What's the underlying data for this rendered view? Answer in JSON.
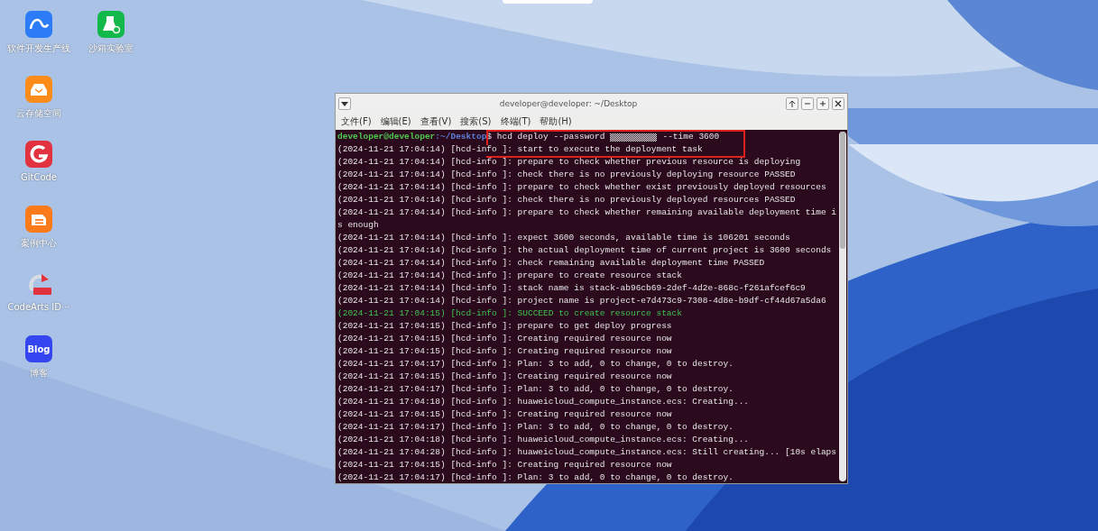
{
  "desktop_icons": [
    {
      "label": "软件开发生产线",
      "kind": "pipeline"
    },
    {
      "label": "沙箱实验室",
      "kind": "sandbox"
    },
    {
      "label": "云存储空间",
      "kind": "storage"
    },
    {
      "label": "GitCode",
      "kind": "gitcode"
    },
    {
      "label": "案例中心",
      "kind": "cases"
    },
    {
      "label": "CodeArts ID···",
      "kind": "java"
    },
    {
      "label": "博客",
      "kind": "blog",
      "badge": "Blog"
    }
  ],
  "terminal": {
    "title": "developer@developer: ~/Desktop",
    "menu": [
      "文件(F)",
      "编辑(E)",
      "查看(V)",
      "搜索(S)",
      "终端(T)",
      "帮助(H)"
    ],
    "prompt": {
      "user": "developer@developer",
      "path": ":~/Desktop",
      "command": "$ hcd deploy --password",
      "command_end": "--time 3600"
    },
    "lines": [
      {
        "text": "(2024-11-21 17:04:14) [hcd-info ]: start to execute the deployment task",
        "kind": "normal"
      },
      {
        "text": "(2024-11-21 17:04:14) [hcd-info ]: prepare to check whether previous resource is deploying",
        "kind": "normal"
      },
      {
        "text": "(2024-11-21 17:04:14) [hcd-info ]: check there is no previously deploying resource PASSED",
        "kind": "normal"
      },
      {
        "text": "(2024-11-21 17:04:14) [hcd-info ]: prepare to check whether exist previously deployed resources",
        "kind": "normal"
      },
      {
        "text": "(2024-11-21 17:04:14) [hcd-info ]: check there is no previously deployed resources PASSED",
        "kind": "normal"
      },
      {
        "text": "(2024-11-21 17:04:14) [hcd-info ]: prepare to check whether remaining available deployment time i",
        "kind": "normal"
      },
      {
        "text": "s enough",
        "kind": "normal"
      },
      {
        "text": "(2024-11-21 17:04:14) [hcd-info ]: expect 3600 seconds, available time is 106201 seconds",
        "kind": "normal"
      },
      {
        "text": "(2024-11-21 17:04:14) [hcd-info ]: the actual deployment time of current project is 3600 seconds",
        "kind": "normal"
      },
      {
        "text": "(2024-11-21 17:04:14) [hcd-info ]: check remaining available deployment time PASSED",
        "kind": "normal"
      },
      {
        "text": "(2024-11-21 17:04:14) [hcd-info ]: prepare to create resource stack",
        "kind": "normal"
      },
      {
        "text": "(2024-11-21 17:04:14) [hcd-info ]: stack name is stack-ab96cb69-2def-4d2e-868c-f261afcef6c9",
        "kind": "normal"
      },
      {
        "text": "(2024-11-21 17:04:14) [hcd-info ]: project name is project-e7d473c9-7308-4d8e-b9df-cf44d67a5da6",
        "kind": "normal"
      },
      {
        "text": "(2024-11-21 17:04:15) [hcd-info ]: SUCCEED to create resource stack",
        "kind": "success"
      },
      {
        "text": "(2024-11-21 17:04:15) [hcd-info ]: prepare to get deploy progress",
        "kind": "normal"
      },
      {
        "text": "(2024-11-21 17:04:15) [hcd-info ]: Creating required resource now",
        "kind": "normal"
      },
      {
        "text": "(2024-11-21 17:04:15) [hcd-info ]: Creating required resource now",
        "kind": "normal"
      },
      {
        "text": "(2024-11-21 17:04:17) [hcd-info ]: Plan: 3 to add, 0 to change, 0 to destroy.",
        "kind": "normal"
      },
      {
        "text": "(2024-11-21 17:04:15) [hcd-info ]: Creating required resource now",
        "kind": "normal"
      },
      {
        "text": "(2024-11-21 17:04:17) [hcd-info ]: Plan: 3 to add, 0 to change, 0 to destroy.",
        "kind": "normal"
      },
      {
        "text": "(2024-11-21 17:04:18) [hcd-info ]: huaweicloud_compute_instance.ecs: Creating...",
        "kind": "normal"
      },
      {
        "text": "(2024-11-21 17:04:15) [hcd-info ]: Creating required resource now",
        "kind": "normal"
      },
      {
        "text": "(2024-11-21 17:04:17) [hcd-info ]: Plan: 3 to add, 0 to change, 0 to destroy.",
        "kind": "normal"
      },
      {
        "text": "(2024-11-21 17:04:18) [hcd-info ]: huaweicloud_compute_instance.ecs: Creating...",
        "kind": "normal"
      },
      {
        "text": "(2024-11-21 17:04:28) [hcd-info ]: huaweicloud_compute_instance.ecs: Still creating... [10s elaps",
        "kind": "normal"
      },
      {
        "text": "(2024-11-21 17:04:15) [hcd-info ]: Creating required resource now",
        "kind": "normal"
      },
      {
        "text": "(2024-11-21 17:04:17) [hcd-info ]: Plan: 3 to add, 0 to change, 0 to destroy.",
        "kind": "normal"
      }
    ]
  }
}
